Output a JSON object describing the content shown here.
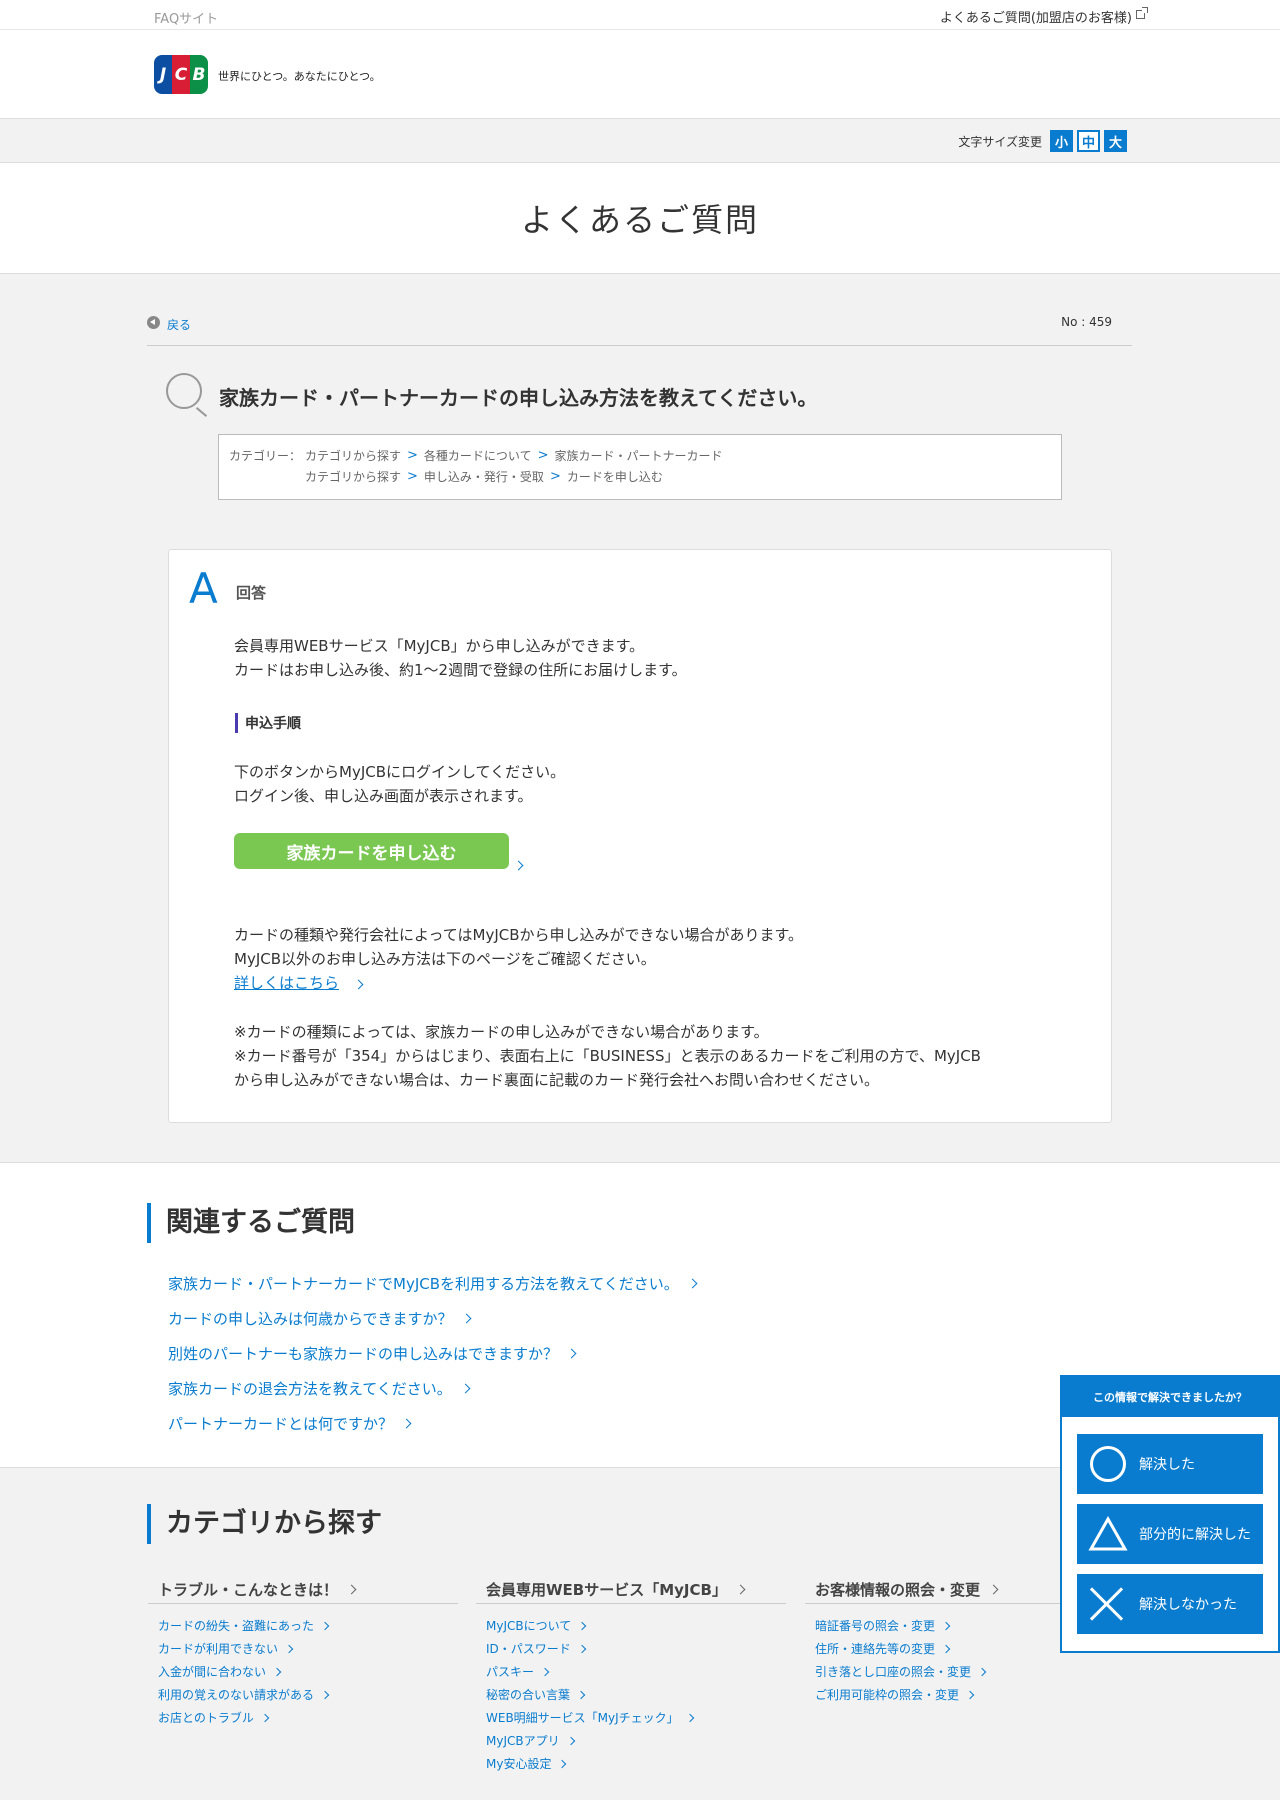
{
  "topbar": {
    "site": "FAQサイト",
    "merchant_link": "よくあるご質問(加盟店のお客様)"
  },
  "header": {
    "logo_letters": [
      "J",
      "C",
      "B"
    ],
    "tagline": "世界にひとつ。あなたにひとつ。"
  },
  "fontsize": {
    "label": "文字サイズ変更",
    "small": "小",
    "medium": "中",
    "large": "大"
  },
  "page_title": "よくあるご質問",
  "faq": {
    "back": "戻る",
    "number": "No : 459",
    "question": "家族カード・パートナーカードの申し込み方法を教えてください。",
    "category_label": "カテゴリー：",
    "category_row1": [
      "カテゴリから探す",
      "各種カードについて",
      "家族カード・パートナーカード"
    ],
    "category_row2": [
      "カテゴリから探す",
      "申し込み・発行・受取",
      "カードを申し込む"
    ],
    "answer_label": "回答",
    "answer_line1": "会員専用WEBサービス「MyJCB」から申し込みができます。",
    "answer_line2": "カードはお申し込み後、約1～2週間で登録の住所にお届けします。",
    "steps_heading": "申込手順",
    "steps_line1": "下のボタンからMyJCBにログインしてください。",
    "steps_line2": "ログイン後、申し込み画面が表示されます。",
    "apply_button": "家族カードを申し込む",
    "note_line1": "カードの種類や発行会社によってはMyJCBから申し込みができない場合があります。",
    "note_line2": "MyJCB以外のお申し込み方法は下のページをご確認ください。",
    "detail_link": "詳しくはこちら",
    "warn_line1": "※カードの種類によっては、家族カードの申し込みができない場合があります。",
    "warn_line2": "※カード番号が「354」からはじまり、表面右上に「BUSINESS」と表示のあるカードをご利用の方で、MyJCB",
    "warn_line3": "から申し込みができない場合は、カード裏面に記載のカード発行会社へお問い合わせください。"
  },
  "related": {
    "title": "関連するご質問",
    "items": [
      "家族カード・パートナーカードでMyJCBを利用する方法を教えてください。",
      "カードの申し込みは何歳からできますか？",
      "別姓のパートナーも家族カードの申し込みはできますか？",
      "家族カードの退会方法を教えてください。",
      "パートナーカードとは何ですか？"
    ]
  },
  "categories": {
    "title": "カテゴリから探す",
    "columns": [
      {
        "heading": "トラブル・こんなときは！",
        "items": [
          "カードの紛失・盗難にあった",
          "カードが利用できない",
          "入金が間に合わない",
          "利用の覚えのない請求がある",
          "お店とのトラブル"
        ]
      },
      {
        "heading": "会員専用WEBサービス「MyJCB」",
        "items": [
          "MyJCBについて",
          "ID・パスワード",
          "パスキー",
          "秘密の合い言葉",
          "WEB明細サービス「MyJチェック」",
          "MyJCBアプリ",
          "My安心設定"
        ]
      },
      {
        "heading": "お客様情報の照会・変更",
        "items": [
          "暗証番号の照会・変更",
          "住所・連絡先等の変更",
          "引き落とし口座の照会・変更",
          "ご利用可能枠の照会・変更"
        ]
      }
    ]
  },
  "feedback": {
    "title": "この情報で解決できましたか？",
    "resolved": "解決した",
    "partial": "部分的に解決した",
    "unresolved": "解決しなかった"
  },
  "colors": {
    "accent": "#0a7ccf",
    "button_green": "#7ac752",
    "background_gray": "#f2f2f2"
  }
}
